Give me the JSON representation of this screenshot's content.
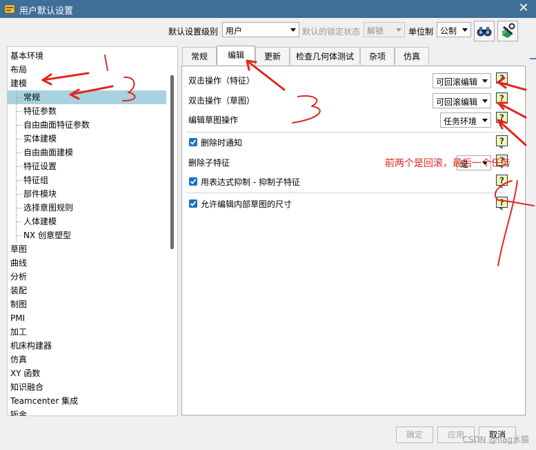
{
  "window": {
    "title": "用户默认设置",
    "close": "✕"
  },
  "toolbar": {
    "level_label": "默认设置级别",
    "level_value": "用户",
    "lock_label": "默认的锁定状态",
    "lock_value": "解锁",
    "unit_label": "单位制",
    "unit_value": "公制"
  },
  "tree": {
    "items": [
      {
        "label": "基本环境",
        "indent": 0
      },
      {
        "label": "布局",
        "indent": 0
      },
      {
        "label": "建模",
        "indent": 0
      },
      {
        "label": "常规",
        "indent": 1,
        "selected": true
      },
      {
        "label": "特征参数",
        "indent": 1
      },
      {
        "label": "自由曲面特征参数",
        "indent": 1
      },
      {
        "label": "实体建模",
        "indent": 1
      },
      {
        "label": "自由曲面建模",
        "indent": 1
      },
      {
        "label": "特征设置",
        "indent": 1
      },
      {
        "label": "特征组",
        "indent": 1
      },
      {
        "label": "部件模块",
        "indent": 1
      },
      {
        "label": "选择意图规则",
        "indent": 1
      },
      {
        "label": "人体建模",
        "indent": 1
      },
      {
        "label": "NX 创意塑型",
        "indent": 1
      },
      {
        "label": "草图",
        "indent": 0
      },
      {
        "label": "曲线",
        "indent": 0
      },
      {
        "label": "分析",
        "indent": 0
      },
      {
        "label": "装配",
        "indent": 0
      },
      {
        "label": "制图",
        "indent": 0
      },
      {
        "label": "PMI",
        "indent": 0
      },
      {
        "label": "加工",
        "indent": 0
      },
      {
        "label": "机床构建器",
        "indent": 0
      },
      {
        "label": "仿真",
        "indent": 0
      },
      {
        "label": "XY 函数",
        "indent": 0
      },
      {
        "label": "知识融合",
        "indent": 0
      },
      {
        "label": "Teamcenter 集成",
        "indent": 0
      },
      {
        "label": "钣金",
        "indent": 0
      }
    ]
  },
  "tabs": [
    "常规",
    "编辑",
    "更新",
    "检查几何体测试",
    "杂项",
    "仿真"
  ],
  "active_tab": "编辑",
  "settings": {
    "double_click_feature_label": "双击操作（特征）",
    "double_click_feature_value": "可回滚编辑",
    "double_click_sketch_label": "双击操作（草图）",
    "double_click_sketch_value": "可回滚编辑",
    "edit_sketch_label": "编辑草图操作",
    "edit_sketch_value": "任务环境",
    "notify_delete_label": "删除时通知",
    "delete_child_label": "删除子特征",
    "delete_child_value": "是",
    "suppress_label": "用表达式抑制 - 抑制子特征",
    "allow_edit_label": "允许编辑内部草图的尺寸"
  },
  "buttons": {
    "ok": "确定",
    "apply": "应用",
    "cancel": "取消"
  },
  "annotation": {
    "text": "前两个是回滚，最后一个任务",
    "color": "#e2261f"
  },
  "watermark": "CSDN @flag水猫"
}
